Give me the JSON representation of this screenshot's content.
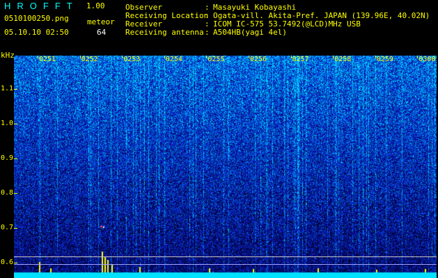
{
  "app": {
    "title": "HROFFT",
    "version": "1.00"
  },
  "info": {
    "filename": "0510100250.png",
    "datetime": "05.10.10 02:50",
    "mode_label": "meteor",
    "count": "64"
  },
  "station": {
    "rows": [
      {
        "key": "Observer",
        "value": "Masayuki Kobayashi"
      },
      {
        "key": "Receiving Location",
        "value": "Ogata-vill. Akita-Pref. JAPAN (139.96E, 40.02N)"
      },
      {
        "key": "Receiver",
        "value": "ICOM IC-575 53.7492(@LCD)MHz USB"
      },
      {
        "key": "Receiving antenna",
        "value": "A504HB(yagi 4el)"
      }
    ],
    "separator": ":"
  },
  "plot": {
    "y_unit": "kHz",
    "y_ticks": [
      "1.1",
      "1.0",
      "0.9",
      "0.8",
      "0.7",
      "0.6"
    ],
    "time_labels": [
      "0251",
      "0252",
      "0253",
      "0254",
      "0255",
      "0256",
      "0257",
      "0258",
      "0259",
      "0300"
    ]
  },
  "colors": {
    "title": "#00ffff",
    "label": "#ffff00",
    "value": "#ffffff",
    "accent": "#00ffff"
  }
}
